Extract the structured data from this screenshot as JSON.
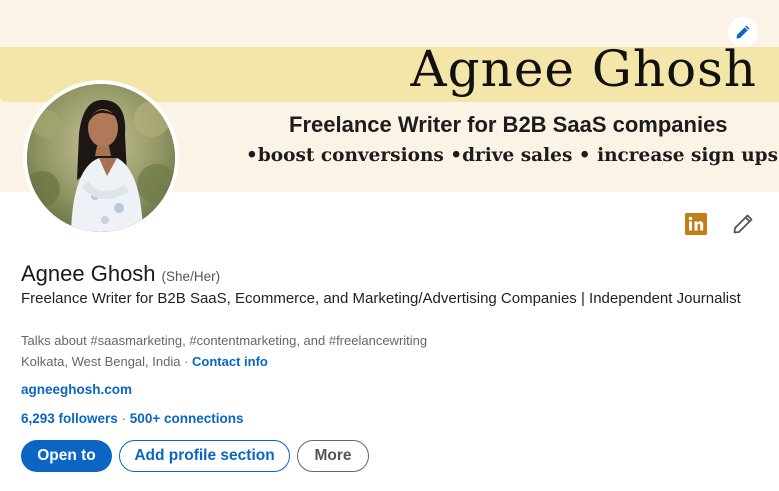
{
  "banner": {
    "name": "Agnee Ghosh",
    "tagline": "Freelance Writer for B2B SaaS companies",
    "bullets": "•boost conversions •drive sales • increase sign ups"
  },
  "profile": {
    "name": "Agnee Ghosh",
    "pronouns": "(She/Her)",
    "headline": "Freelance Writer for B2B SaaS, Ecommerce, and Marketing/Advertising Companies | Independent Journalist",
    "talks_about": "Talks about #saasmarketing, #contentmarketing, and #freelancewriting",
    "location": "Kolkata, West Bengal, India",
    "location_sep": " · ",
    "contact_info": "Contact info",
    "website": "agneeghosh.com",
    "followers": "6,293 followers",
    "connections_sep": " · ",
    "connections": "500+ connections"
  },
  "actions": {
    "open_to": "Open to",
    "add_section": "Add profile section",
    "more": "More"
  },
  "colors": {
    "accent": "#0a66c2",
    "banner_bg": "#fbf4e6",
    "banner_stripe": "#f4e5a9",
    "linkedin_badge": "#c37d16"
  },
  "icons": {
    "edit_cover": "pencil-icon",
    "linkedin": "linkedin-icon",
    "edit_intro": "pencil-icon"
  }
}
